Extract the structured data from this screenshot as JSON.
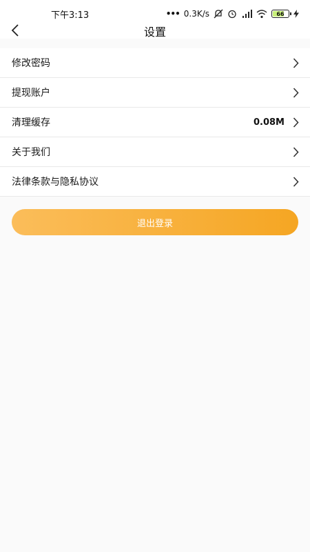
{
  "status_bar": {
    "time": "下午3:13",
    "network_speed": "0.3K/s",
    "battery_level": "66"
  },
  "nav": {
    "title": "设置"
  },
  "settings": [
    {
      "label": "修改密码",
      "value": ""
    },
    {
      "label": "提现账户",
      "value": ""
    },
    {
      "label": "清理缓存",
      "value": "0.08M"
    },
    {
      "label": "关于我们",
      "value": ""
    },
    {
      "label": "法律条款与隐私协议",
      "value": ""
    }
  ],
  "logout_label": "退出登录",
  "colors": {
    "accent_start": "#fbbd5a",
    "accent_end": "#f5a623",
    "background": "#fafafa"
  }
}
